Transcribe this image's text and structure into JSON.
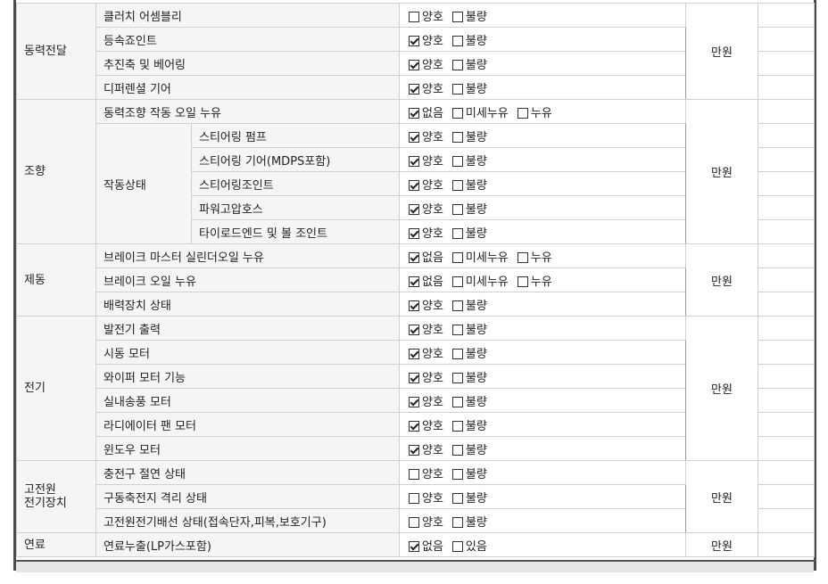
{
  "unit": "만원",
  "groups": [
    {
      "category": "동력전달",
      "rows": [
        {
          "item": "클러치 어셈블리",
          "options": [
            {
              "label": "양호",
              "checked": false
            },
            {
              "label": "불량",
              "checked": false
            }
          ]
        },
        {
          "item": "등속죠인트",
          "options": [
            {
              "label": "양호",
              "checked": true
            },
            {
              "label": "불량",
              "checked": false
            }
          ]
        },
        {
          "item": "추진축 및 베어링",
          "options": [
            {
              "label": "양호",
              "checked": true
            },
            {
              "label": "불량",
              "checked": false
            }
          ]
        },
        {
          "item": "디퍼렌셜 기어",
          "options": [
            {
              "label": "양호",
              "checked": true
            },
            {
              "label": "불량",
              "checked": false
            }
          ]
        }
      ]
    },
    {
      "category": "조향",
      "rows": [
        {
          "item": "동력조향 작동 오일 누유",
          "options": [
            {
              "label": "없음",
              "checked": true
            },
            {
              "label": "미세누유",
              "checked": false
            },
            {
              "label": "누유",
              "checked": false
            }
          ]
        },
        {
          "sub": "작동상태",
          "item": "스티어링 펌프",
          "options": [
            {
              "label": "양호",
              "checked": true
            },
            {
              "label": "불량",
              "checked": false
            }
          ]
        },
        {
          "item": "스티어링 기어(MDPS포함)",
          "options": [
            {
              "label": "양호",
              "checked": true
            },
            {
              "label": "불량",
              "checked": false
            }
          ]
        },
        {
          "item": "스티어링조인트",
          "options": [
            {
              "label": "양호",
              "checked": true
            },
            {
              "label": "불량",
              "checked": false
            }
          ]
        },
        {
          "item": "파워고압호스",
          "options": [
            {
              "label": "양호",
              "checked": true
            },
            {
              "label": "불량",
              "checked": false
            }
          ]
        },
        {
          "item": "타이로드엔드 및 볼 조인트",
          "options": [
            {
              "label": "양호",
              "checked": true
            },
            {
              "label": "불량",
              "checked": false
            }
          ]
        }
      ]
    },
    {
      "category": "제동",
      "rows": [
        {
          "item": "브레이크 마스터 실린더오일 누유",
          "options": [
            {
              "label": "없음",
              "checked": true
            },
            {
              "label": "미세누유",
              "checked": false
            },
            {
              "label": "누유",
              "checked": false
            }
          ]
        },
        {
          "item": "브레이크 오일 누유",
          "options": [
            {
              "label": "없음",
              "checked": true
            },
            {
              "label": "미세누유",
              "checked": false
            },
            {
              "label": "누유",
              "checked": false
            }
          ]
        },
        {
          "item": "배력장치 상태",
          "options": [
            {
              "label": "양호",
              "checked": true
            },
            {
              "label": "불량",
              "checked": false
            }
          ]
        }
      ]
    },
    {
      "category": "전기",
      "rows": [
        {
          "item": "발전기 출력",
          "options": [
            {
              "label": "양호",
              "checked": true
            },
            {
              "label": "불량",
              "checked": false
            }
          ]
        },
        {
          "item": "시동 모터",
          "options": [
            {
              "label": "양호",
              "checked": true
            },
            {
              "label": "불량",
              "checked": false
            }
          ]
        },
        {
          "item": "와이퍼 모터 기능",
          "options": [
            {
              "label": "양호",
              "checked": true
            },
            {
              "label": "불량",
              "checked": false
            }
          ]
        },
        {
          "item": "실내송풍 모터",
          "options": [
            {
              "label": "양호",
              "checked": true
            },
            {
              "label": "불량",
              "checked": false
            }
          ]
        },
        {
          "item": "라디에이터 팬 모터",
          "options": [
            {
              "label": "양호",
              "checked": true
            },
            {
              "label": "불량",
              "checked": false
            }
          ]
        },
        {
          "item": "윈도우 모터",
          "options": [
            {
              "label": "양호",
              "checked": true
            },
            {
              "label": "불량",
              "checked": false
            }
          ]
        }
      ]
    },
    {
      "category": "고전원\n전기장치",
      "rows": [
        {
          "item": "충전구 절연 상태",
          "options": [
            {
              "label": "양호",
              "checked": false
            },
            {
              "label": "불량",
              "checked": false
            }
          ]
        },
        {
          "item": "구동축전지 격리 상태",
          "options": [
            {
              "label": "양호",
              "checked": false
            },
            {
              "label": "불량",
              "checked": false
            }
          ]
        },
        {
          "item": "고전원전기배선 상태(접속단자,피복,보호기구)",
          "options": [
            {
              "label": "양호",
              "checked": false
            },
            {
              "label": "불량",
              "checked": false
            }
          ]
        }
      ]
    },
    {
      "category": "연료",
      "rows": [
        {
          "item": "연료누출(LP가스포함)",
          "options": [
            {
              "label": "없음",
              "checked": true
            },
            {
              "label": "있음",
              "checked": false
            }
          ]
        }
      ]
    }
  ]
}
